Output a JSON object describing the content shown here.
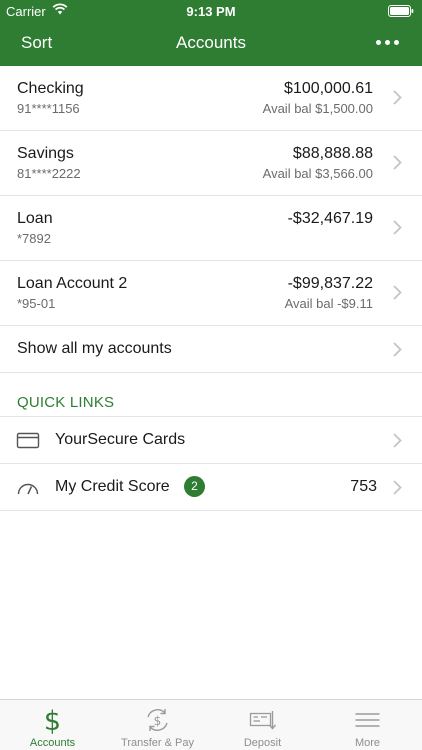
{
  "status": {
    "carrier": "Carrier",
    "time": "9:13 PM"
  },
  "nav": {
    "sort_label": "Sort",
    "title": "Accounts"
  },
  "accounts": [
    {
      "name": "Checking",
      "number": "91****1156",
      "balance": "$100,000.61",
      "available": "Avail bal $1,500.00"
    },
    {
      "name": "Savings",
      "number": "81****2222",
      "balance": "$88,888.88",
      "available": "Avail bal $3,566.00"
    },
    {
      "name": "Loan",
      "number": "*7892",
      "balance": "-$32,467.19",
      "available": ""
    },
    {
      "name": "Loan Account 2",
      "number": "*95-01",
      "balance": "-$99,837.22",
      "available": "Avail bal -$9.11"
    }
  ],
  "show_all_label": "Show all my accounts",
  "quick_links": {
    "header": "QUICK LINKS",
    "items": [
      {
        "label": "YourSecure Cards",
        "icon": "card-icon"
      },
      {
        "label": "My Credit Score",
        "icon": "gauge-icon",
        "badge": "2",
        "value": "753"
      }
    ]
  },
  "tabs": [
    {
      "label": "Accounts",
      "icon": "dollar-icon",
      "active": true
    },
    {
      "label": "Transfer & Pay",
      "icon": "transfer-icon",
      "active": false
    },
    {
      "label": "Deposit",
      "icon": "deposit-icon",
      "active": false
    },
    {
      "label": "More",
      "icon": "menu-icon",
      "active": false
    }
  ],
  "colors": {
    "brand": "#2e7d32",
    "separator": "#e4e4e4",
    "muted": "#8e8e93"
  }
}
